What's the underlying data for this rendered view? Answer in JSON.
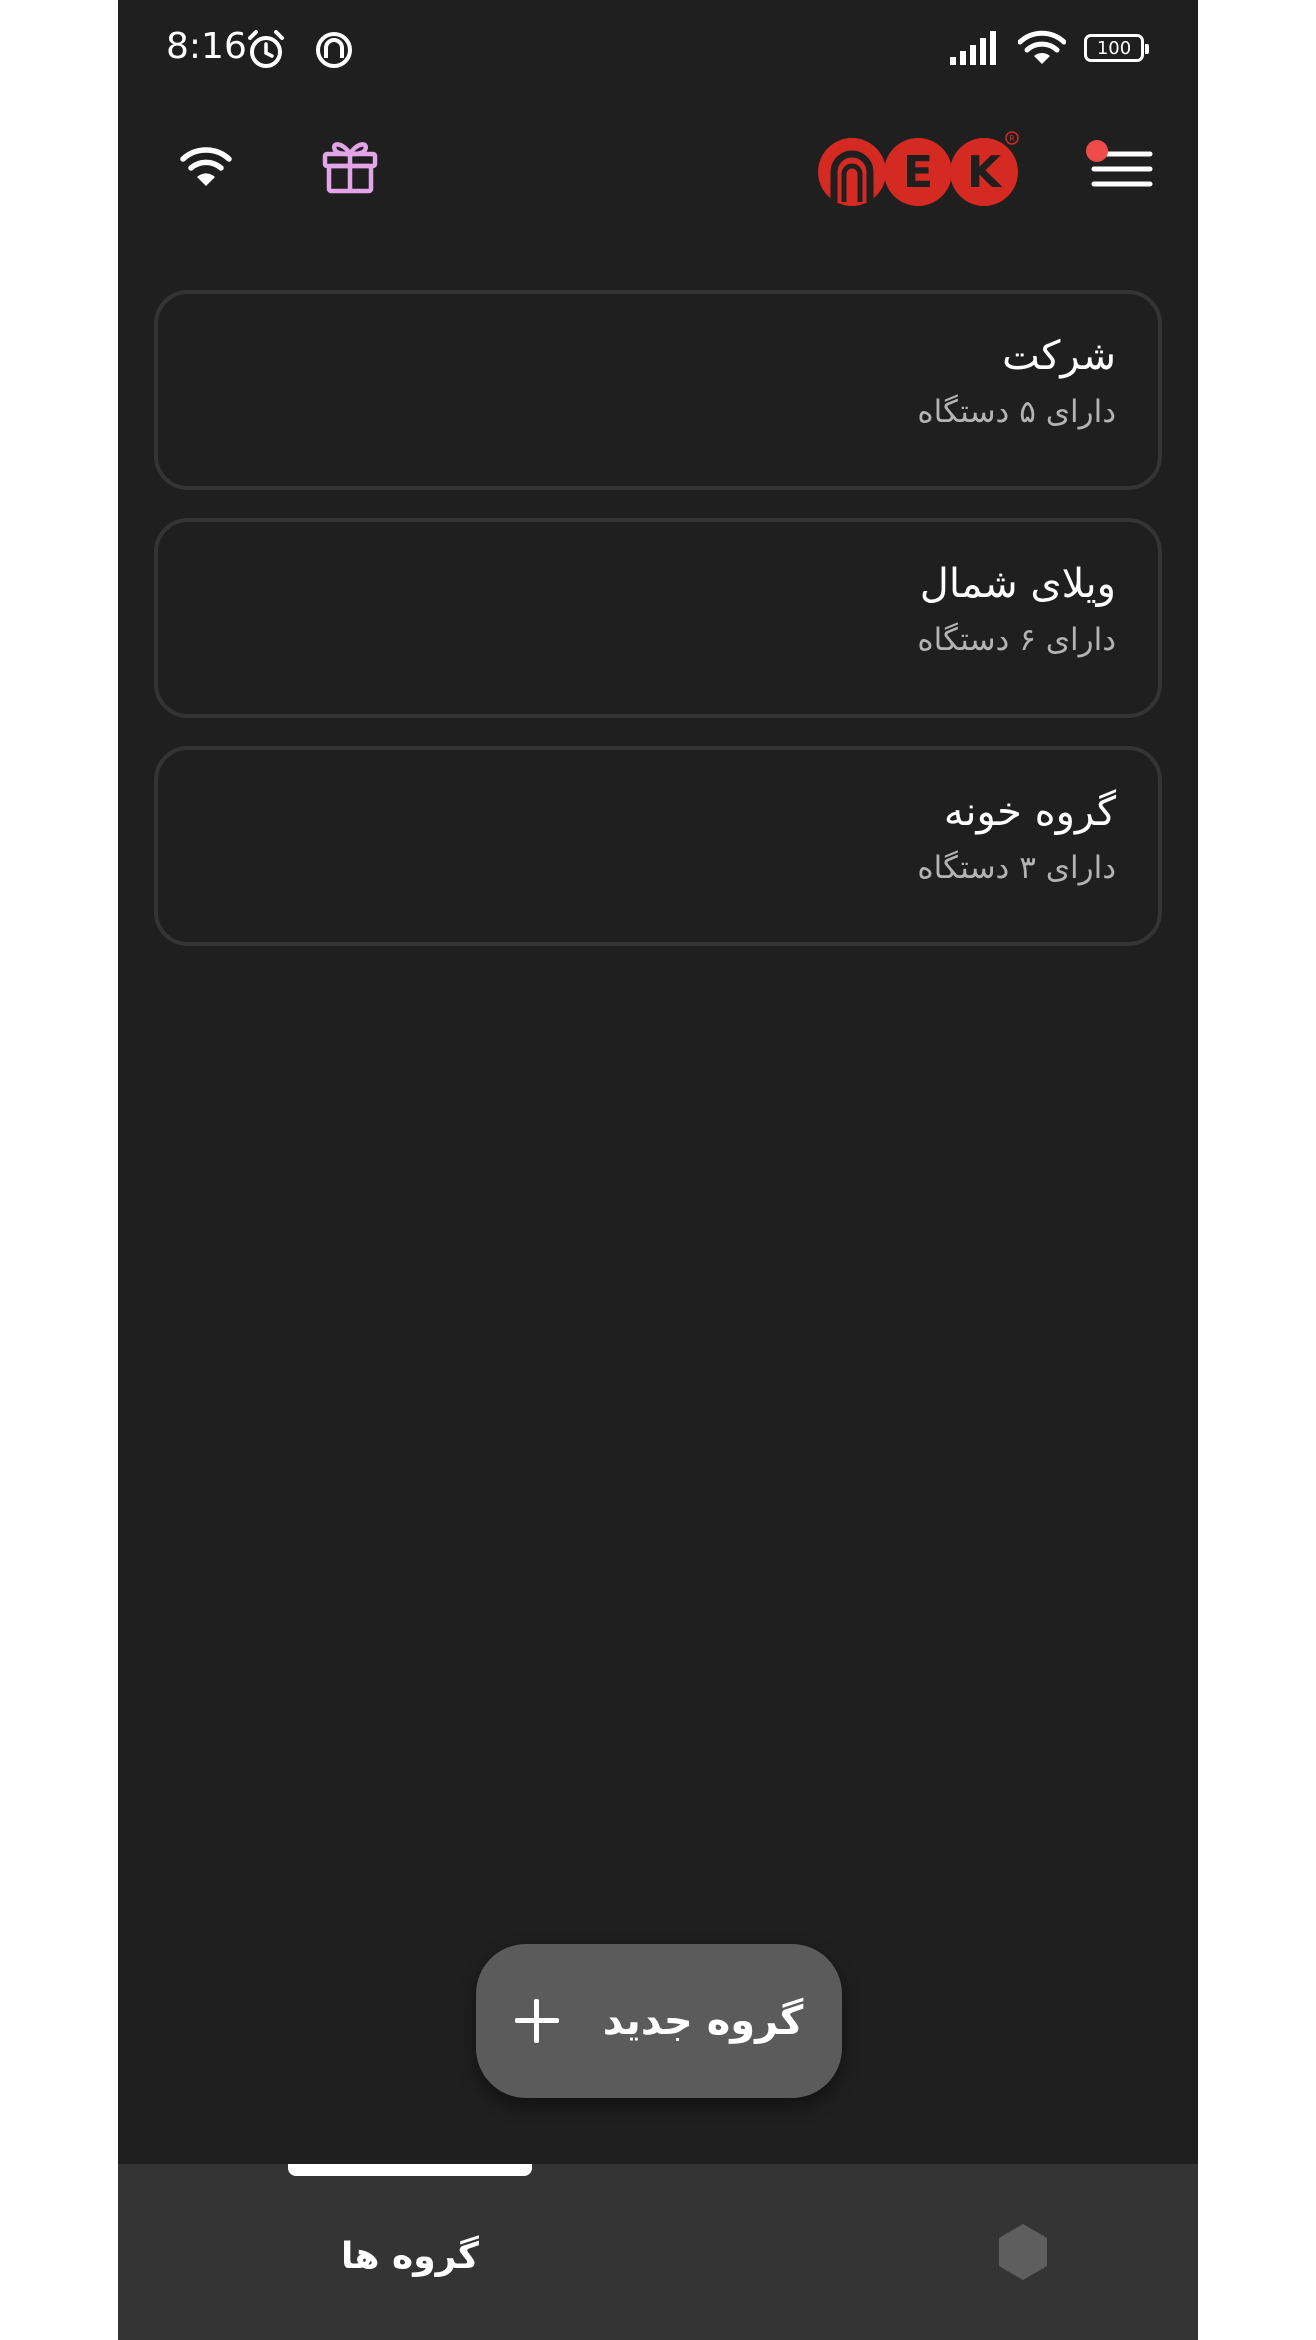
{
  "status_bar": {
    "time": "8:16",
    "battery": "100"
  },
  "app_bar": {
    "logo_letters": [
      "",
      "E",
      "K"
    ],
    "colors": {
      "logo_red": "#d42a22",
      "gift_accent": "#e3a5e8",
      "notification_dot": "#f04b4b"
    }
  },
  "groups": [
    {
      "name": "شرکت",
      "count": "دارای ۵ دستگاه"
    },
    {
      "name": "ویلای شمال",
      "count": "دارای ۶ دستگاه"
    },
    {
      "name": "گروه خونه",
      "count": "دارای ۳ دستگاه"
    }
  ],
  "fab": {
    "label": "گروه جدید"
  },
  "bottom_nav": {
    "groups_label": "گروه ها",
    "devices_icon": "hexagon-icon"
  }
}
